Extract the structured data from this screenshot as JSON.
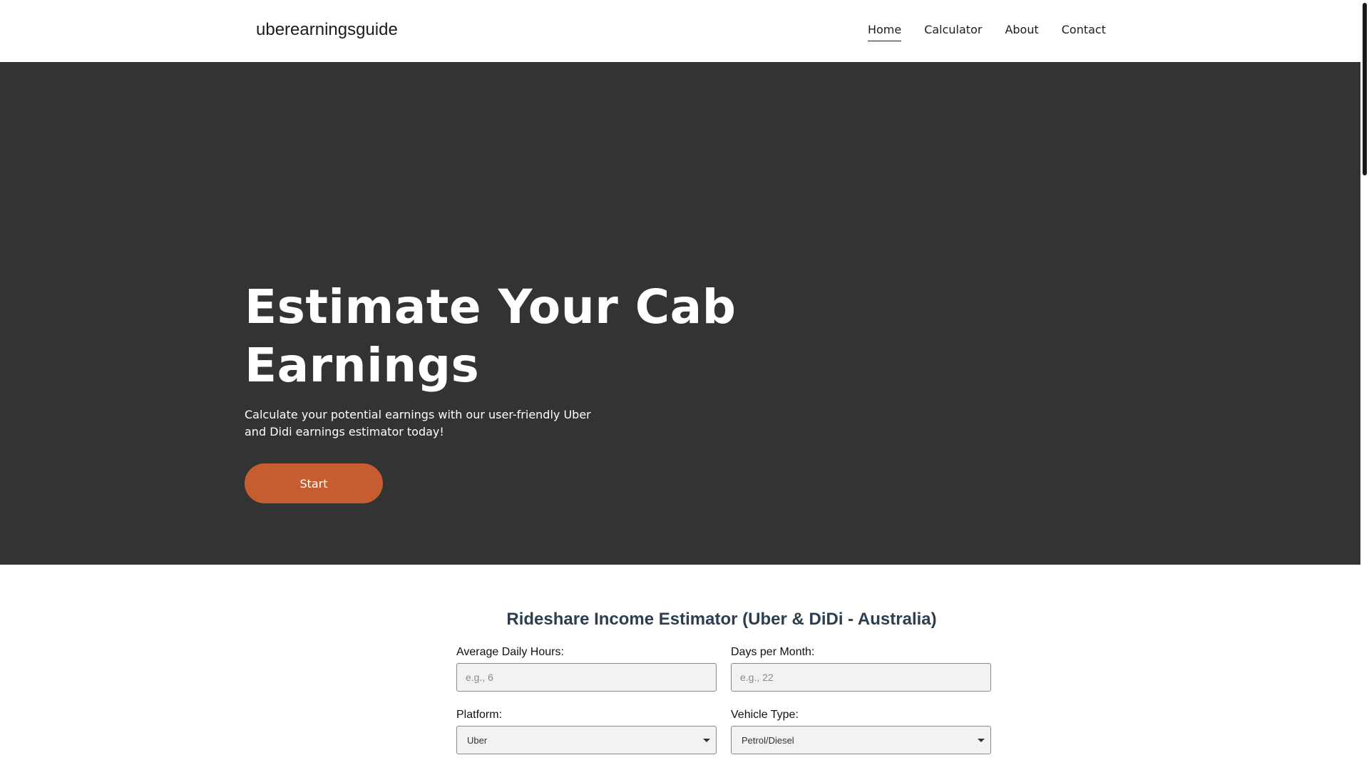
{
  "header": {
    "logo": "uberearningsguide",
    "nav": [
      {
        "label": "Home"
      },
      {
        "label": "Calculator"
      },
      {
        "label": "About"
      },
      {
        "label": "Contact"
      }
    ]
  },
  "hero": {
    "title": "Estimate Your Cab Earnings",
    "subtitle": "Calculate your potential earnings with our user-friendly Uber and Didi earnings estimator today!",
    "button": "Start"
  },
  "calculator": {
    "title": "Rideshare Income Estimator (Uber & DiDi - Australia)",
    "daily_hours": {
      "label": "Average Daily Hours:",
      "placeholder": "e.g., 6"
    },
    "days_per_month": {
      "label": "Days per Month:",
      "placeholder": "e.g., 22"
    },
    "platform": {
      "label": "Platform:",
      "value": "Uber"
    },
    "vehicle_type": {
      "label": "Vehicle Type:",
      "value": "Petrol/Diesel"
    }
  },
  "colors": {
    "hero_bg": "#333333",
    "accent": "#c65d31",
    "calc_title": "#2c3e50"
  }
}
